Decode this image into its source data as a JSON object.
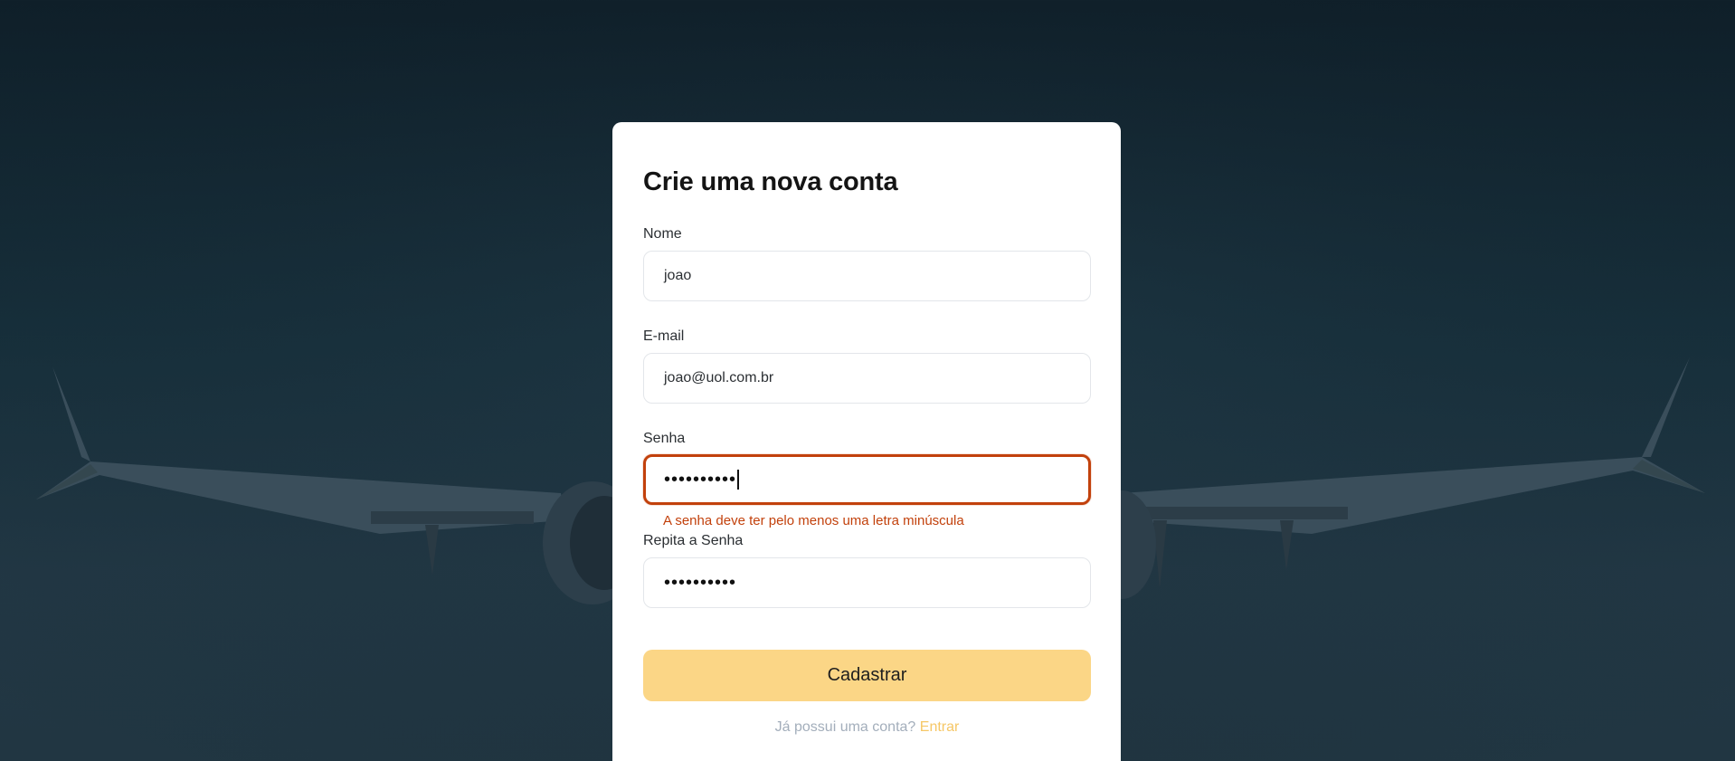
{
  "form": {
    "title": "Crie uma nova conta",
    "name": {
      "label": "Nome",
      "value": "joao"
    },
    "email": {
      "label": "E-mail",
      "value": "joao@uol.com.br"
    },
    "password": {
      "label": "Senha",
      "value": "••••••••••",
      "error": "A senha deve ter pelo menos uma letra minúscula"
    },
    "confirm_password": {
      "label": "Repita a Senha",
      "value": "••••••••••"
    },
    "submit_label": "Cadastrar",
    "footer_text": "Já possui uma conta?",
    "footer_link": "Entrar"
  },
  "colors": {
    "accent": "#fbd686",
    "error": "#c2410c",
    "link": "#f6c766"
  }
}
